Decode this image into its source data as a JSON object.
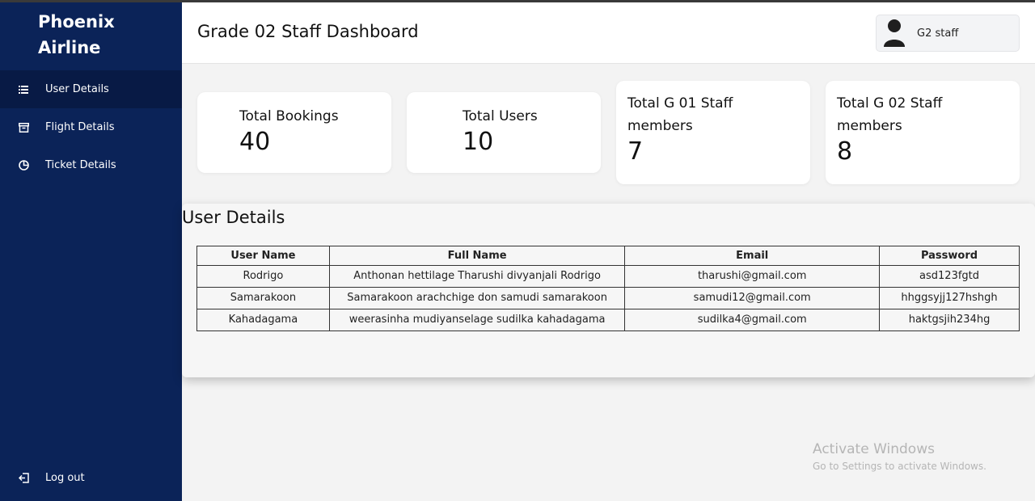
{
  "app": {
    "brand_line1": "Phoenix",
    "brand_line2": "Airline"
  },
  "sidebar": {
    "items": [
      {
        "label": "User Details",
        "icon": "list-icon",
        "active": true
      },
      {
        "label": "Flight Details",
        "icon": "archive-icon",
        "active": false
      },
      {
        "label": "Ticket Details",
        "icon": "pie-chart-icon",
        "active": false
      }
    ],
    "logout_label": "Log out"
  },
  "header": {
    "title": "Grade 02 Staff Dashboard",
    "user_name": "G2 staff"
  },
  "stats": [
    {
      "label": "Total Bookings",
      "value": "40"
    },
    {
      "label": "Total Users",
      "value": "10"
    },
    {
      "label": "Total G 01 Staff members",
      "value": "7"
    },
    {
      "label": "Total G 02 Staff members",
      "value": "8"
    }
  ],
  "user_details": {
    "title": "User Details",
    "columns": [
      "User Name",
      "Full Name",
      "Email",
      "Password"
    ],
    "rows": [
      {
        "user_name": "Rodrigo",
        "full_name": "Anthonan hettilage Tharushi divyanjali Rodrigo",
        "email": "tharushi@gmail.com",
        "password": "asd123fgtd"
      },
      {
        "user_name": "Samarakoon",
        "full_name": "Samarakoon arachchige don samudi samarakoon",
        "email": "samudi12@gmail.com",
        "password": "hhggsyjj127hshgh"
      },
      {
        "user_name": "Kahadagama",
        "full_name": "weerasinha mudiyanselage sudilka kahadagama",
        "email": "sudilka4@gmail.com",
        "password": "haktgsjih234hg"
      }
    ]
  },
  "watermark": {
    "line1": "Activate Windows",
    "line2": "Go to Settings to activate Windows."
  },
  "colors": {
    "sidebar_bg": "#0b2358",
    "sidebar_active_bg": "#081a45",
    "page_bg": "#f3f3f3"
  }
}
